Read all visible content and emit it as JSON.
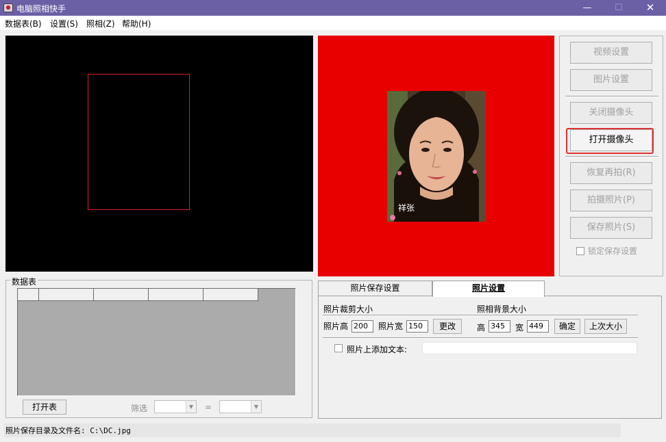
{
  "window": {
    "title": "电脑照相快手",
    "minimize": "—",
    "maximize": "☐",
    "close": "✕"
  },
  "menu": [
    "数据表(B)",
    "设置(S)",
    "照相(Z)",
    "帮助(H)"
  ],
  "preview": {
    "caption": "祥张"
  },
  "side_buttons": [
    "视频设置",
    "图片设置",
    "关闭摄像头",
    "打开摄像头",
    "恢复再拍(R)",
    "拍摄照片(P)",
    "保存照片(S)"
  ],
  "lock_save": {
    "label": "锁定保存设置",
    "checked": false
  },
  "data_table": {
    "group_label": "数据表",
    "open_button": "打开表",
    "filter_label": "筛选",
    "equals": "=",
    "filter_field": "",
    "filter_value": ""
  },
  "tabs": {
    "save_settings": "照片保存设置",
    "photo_settings": "照片设置",
    "active": "照片设置"
  },
  "photo_settings": {
    "crop_title": "照片裁剪大小",
    "height_label": "照片高",
    "height_value": "200",
    "width_label": "照片宽",
    "width_value": "150",
    "change_button": "更改",
    "bg_title": "照相背景大小",
    "bg_height_label": "高",
    "bg_height_value": "345",
    "bg_width_label": "宽",
    "bg_width_value": "449",
    "confirm_button": "确定",
    "last_size_button": "上次大小",
    "add_text_label": "照片上添加文本:",
    "add_text_checked": false,
    "add_text_value": ""
  },
  "status": {
    "text": "照片保存目录及文件名: C:\\DC.jpg"
  },
  "colors": {
    "titlebar": "#6b5fa5",
    "photo_background": "#e80000",
    "crop_frame": "#e02020",
    "highlight": "#e03030"
  }
}
